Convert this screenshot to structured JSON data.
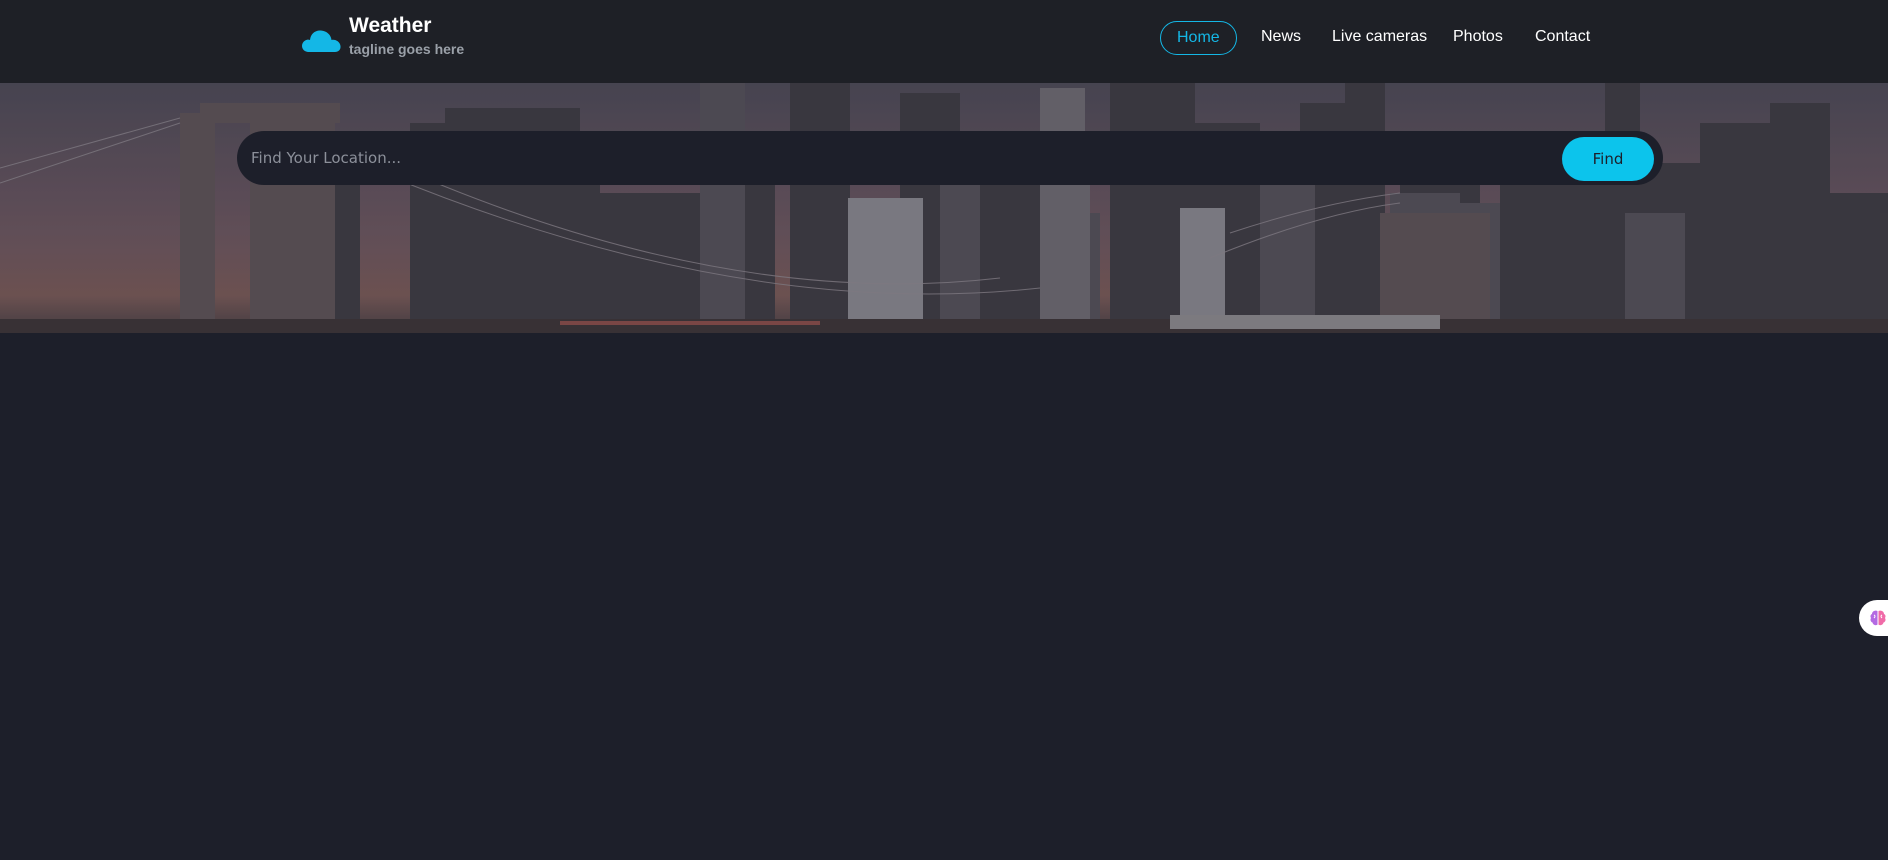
{
  "brand": {
    "title": "Weather",
    "tagline": "tagline goes here",
    "icon": "cloud-icon",
    "icon_color": "#14b7e6"
  },
  "nav": {
    "items": [
      {
        "label": "Home",
        "active": true
      },
      {
        "label": "News",
        "active": false
      },
      {
        "label": "Live cameras",
        "active": false
      },
      {
        "label": "Photos",
        "active": false
      },
      {
        "label": "Contact",
        "active": false
      }
    ]
  },
  "search": {
    "placeholder": "Find Your Location...",
    "button_label": "Find"
  },
  "colors": {
    "accent": "#14b7e6",
    "button": "#0cc4ec",
    "background": "#1d1f2a",
    "header": "#1e2026"
  },
  "widget": {
    "icon": "brain-icon"
  }
}
